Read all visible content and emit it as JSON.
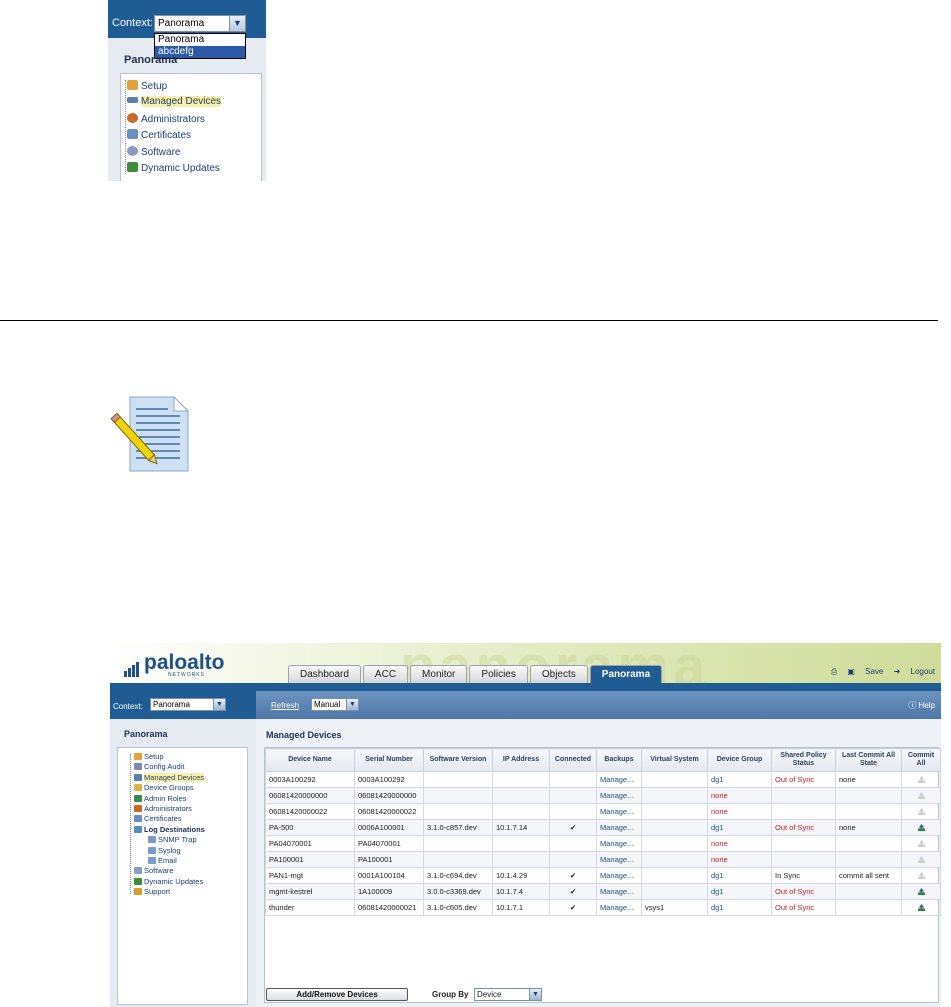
{
  "top_shot": {
    "context_label": "Context:",
    "context_value": "Panorama",
    "dropdown_options": [
      "Panorama",
      "abcdefg"
    ],
    "selected_option": "abcdefg",
    "sidebar_title": "Panorama",
    "tree_items": [
      "Setup",
      "Managed Devices",
      "Administrators",
      "Certificates",
      "Software",
      "Dynamic Updates"
    ],
    "highlighted_item": "Managed Devices"
  },
  "note_icon": "note-pencil-icon",
  "main_shot": {
    "logo_text": "paloalto",
    "logo_sub": "NETWORKS",
    "banner_watermark": "panorama",
    "tabs": [
      "Dashboard",
      "ACC",
      "Monitor",
      "Policies",
      "Objects",
      "Panorama"
    ],
    "active_tab": "Panorama",
    "top_actions": {
      "save": "Save",
      "logout": "Logout"
    },
    "context_label": "Context:",
    "context_value": "Panorama",
    "toolbar": {
      "refresh": "Refresh",
      "mode": "Manual",
      "help": "Help"
    },
    "sidebar_title": "Panorama",
    "tree_items": [
      {
        "label": "Setup",
        "level": 0
      },
      {
        "label": "Config Audit",
        "level": 0
      },
      {
        "label": "Managed Devices",
        "level": 0,
        "highlight": true
      },
      {
        "label": "Device Groups",
        "level": 0
      },
      {
        "label": "Admin Roles",
        "level": 0
      },
      {
        "label": "Administrators",
        "level": 0
      },
      {
        "label": "Certificates",
        "level": 0
      },
      {
        "label": "Log Destinations",
        "level": 0,
        "bold": true
      },
      {
        "label": "SNMP Trap",
        "level": 1
      },
      {
        "label": "Syslog",
        "level": 1
      },
      {
        "label": "Email",
        "level": 1
      },
      {
        "label": "Software",
        "level": 0
      },
      {
        "label": "Dynamic Updates",
        "level": 0
      },
      {
        "label": "Support",
        "level": 0
      }
    ],
    "section_heading": "Managed Devices",
    "columns": [
      "Device Name",
      "Serial Number",
      "Software Version",
      "IP Address",
      "Connected",
      "Backups",
      "Virtual System",
      "Device Group",
      "Shared Policy Status",
      "Last Commit All State",
      "Commit All"
    ],
    "rows": [
      [
        "0003A100292",
        "0003A100292",
        "",
        "",
        "",
        "Manage...",
        "",
        "dg1",
        "Out of Sync",
        "none",
        ""
      ],
      [
        "06081420000000",
        "06081420000000",
        "",
        "",
        "",
        "Manage...",
        "",
        "none",
        "",
        "",
        ""
      ],
      [
        "06081420000022",
        "06081420000022",
        "",
        "",
        "",
        "Manage...",
        "",
        "none",
        "",
        "",
        ""
      ],
      [
        "PA-500",
        "0006A100001",
        "3.1.0-c857.dev",
        "10.1.7.14",
        "✔",
        "Manage...",
        "",
        "dg1",
        "Out of Sync",
        "none",
        ""
      ],
      [
        "PA04070001",
        "PA04070001",
        "",
        "",
        "",
        "Manage...",
        "",
        "none",
        "",
        "",
        ""
      ],
      [
        "PA100001",
        "PA100001",
        "",
        "",
        "",
        "Manage...",
        "",
        "none",
        "",
        "",
        ""
      ],
      [
        "PAN1-mgt",
        "0001A100104",
        "3.1.0-c694.dev",
        "10.1.4.29",
        "✔",
        "Manage...",
        "",
        "dg1",
        "In Sync",
        "commit all sent",
        ""
      ],
      [
        "mgmt-kestrel",
        "1A100009",
        "3.0.0-c3369.dev",
        "10.1.7.4",
        "✔",
        "Manage...",
        "",
        "dg1",
        "Out of Sync",
        "",
        ""
      ],
      [
        "thunder",
        "06081420000021",
        "3.1.0-c605.dev",
        "10.1.7.1",
        "✔",
        "Manage...",
        "vsys1",
        "dg1",
        "Out of Sync",
        "",
        ""
      ]
    ],
    "commit_icon_active": [
      false,
      false,
      false,
      true,
      false,
      false,
      false,
      true,
      true
    ],
    "add_remove_button": "Add/Remove Devices",
    "group_by_label": "Group By",
    "group_by_value": "Device",
    "colors": {
      "accent_blue": "#1f5c93",
      "red": "#d01818",
      "link": "#1d4f8a"
    }
  }
}
